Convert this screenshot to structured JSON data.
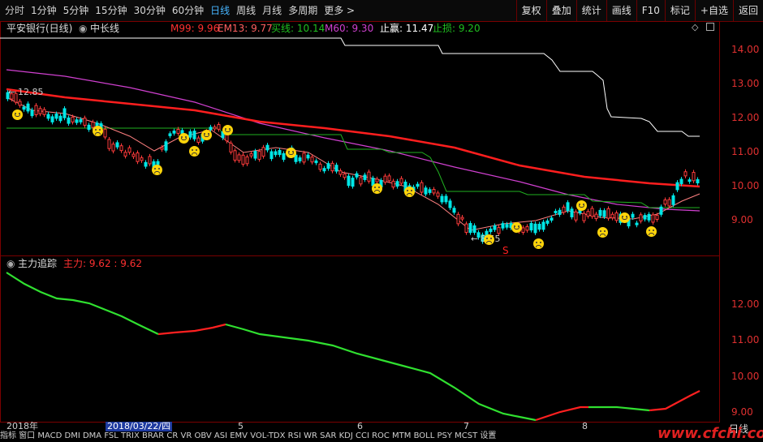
{
  "toolbar": {
    "tabs": [
      "分时",
      "1分钟",
      "5分钟",
      "15分钟",
      "30分钟",
      "60分钟",
      "日线",
      "周线",
      "月线",
      "多周期",
      "更多 >"
    ],
    "active_tab": "日线",
    "right_buttons": [
      "复权",
      "叠加",
      "统计",
      "画线",
      "F10",
      "标记",
      "+自选",
      "返回"
    ]
  },
  "header": {
    "stock": "平安银行(日线)",
    "indicator": "中长线",
    "m99": "M99: 9.96",
    "em13": "EM13: 9.77",
    "buy_line": "买线: 10.14",
    "m60": "M60: 9.30",
    "take_profit": "止赢: 11.47",
    "stop_loss": "止损: 9.20"
  },
  "main_axis": [
    "14.00",
    "13.00",
    "12.00",
    "11.00",
    "10.00",
    "9.00"
  ],
  "annotations": {
    "high": "12.85",
    "low": "8.55",
    "signal": "S"
  },
  "sub": {
    "title": "主力追踪",
    "value": "主力: 9.62 : 9.62",
    "axis": [
      "12.00",
      "11.00",
      "10.00",
      "9.00"
    ]
  },
  "date_bar": {
    "year": "2018年",
    "cursor": "2018/03/22/四",
    "months": [
      "5",
      "6",
      "7",
      "8"
    ],
    "right_label": "日线"
  },
  "indicator_tabs": "指标 窗口 MACD DMI DMA FSL TRIX BRAR CR VR OBV ASI EMV VOL-TDX RSI WR SAR KDJ CCI ROC MTM BOLL PSY MCST 设置",
  "watermark": "www.cfchi.com",
  "colors": {
    "up": "#ff3b3b",
    "down": "#00e6e6",
    "m99": "#ff2020",
    "m60": "#d040d0",
    "buy": "#20b020",
    "takeprofit": "#ffffff",
    "main_up": "#ff2020",
    "main_down": "#30e030"
  }
}
